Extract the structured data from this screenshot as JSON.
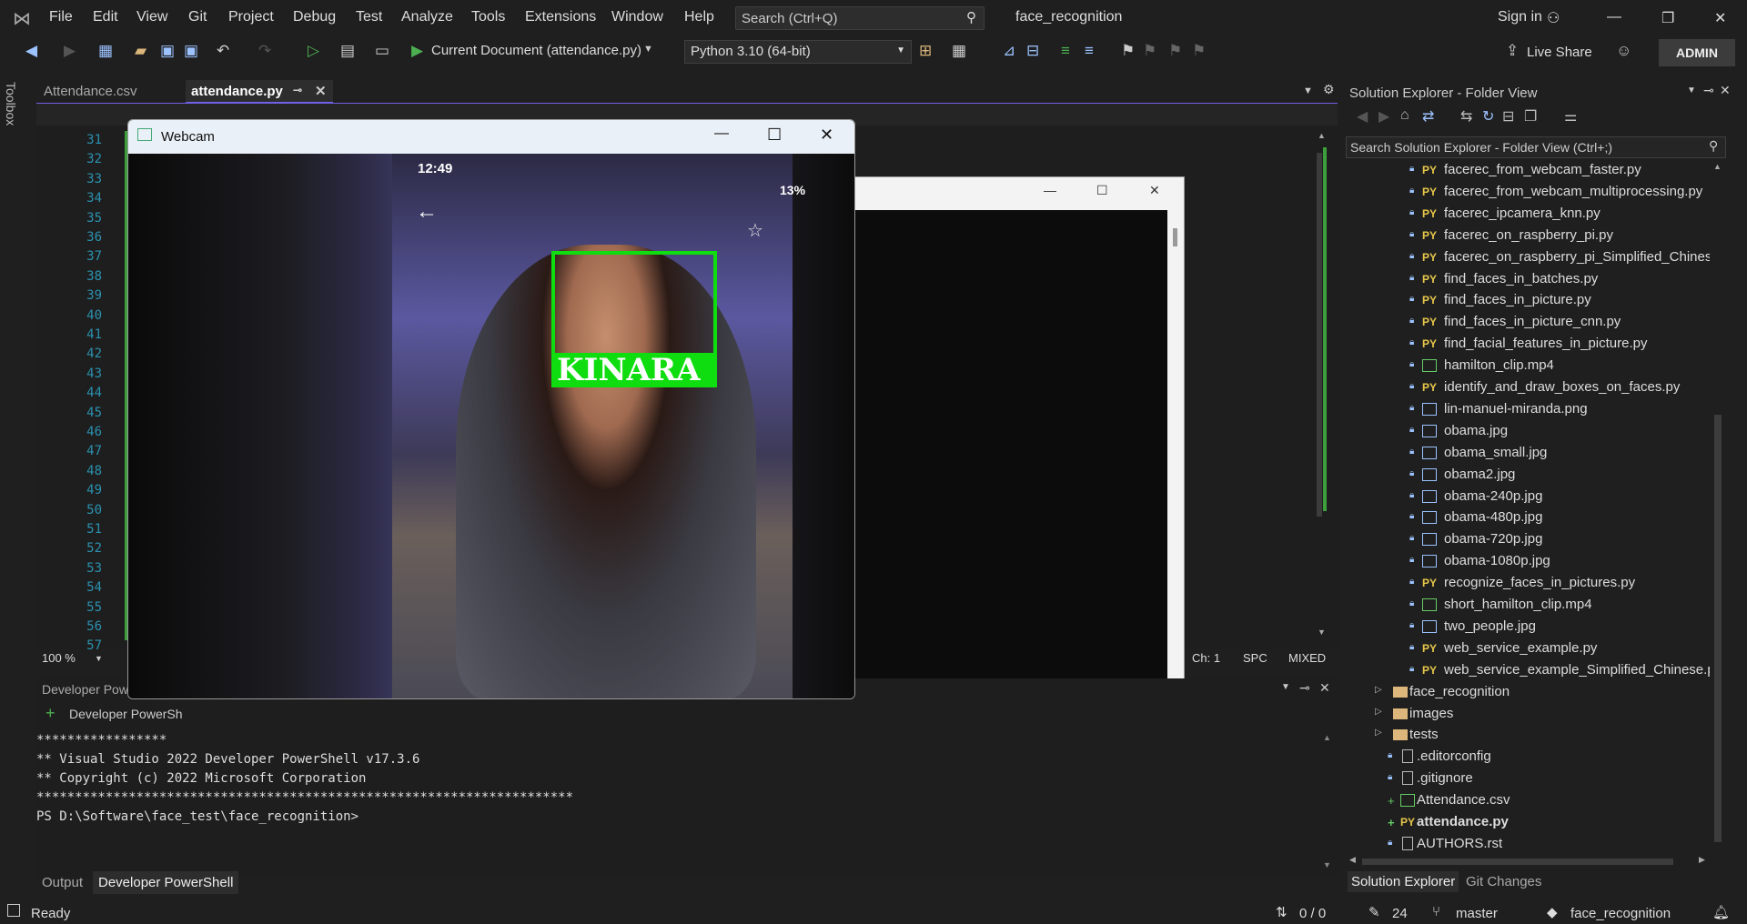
{
  "menu": {
    "items": [
      "File",
      "Edit",
      "View",
      "Git",
      "Project",
      "Debug",
      "Test",
      "Analyze",
      "Tools",
      "Extensions",
      "Window",
      "Help"
    ],
    "search_placeholder": "Search (Ctrl+Q)",
    "solution_name": "face_recognition",
    "sign_in": "Sign in"
  },
  "toolbar": {
    "run_target": "Current Document (attendance.py)",
    "interpreter": "Python 3.10 (64-bit)",
    "live_share": "Live Share",
    "admin": "ADMIN"
  },
  "left_rail": {
    "toolbox": "Toolbox"
  },
  "editor": {
    "tabs": [
      "Attendance.csv",
      "attendance.py"
    ],
    "line_numbers": [
      "31",
      "32",
      "33",
      "34",
      "35",
      "36",
      "37",
      "38",
      "39",
      "40",
      "41",
      "42",
      "43",
      "44",
      "45",
      "46",
      "47",
      "48",
      "49",
      "50",
      "51",
      "52",
      "53",
      "54",
      "55",
      "56",
      "57"
    ],
    "zoom": "100 %",
    "ch": "Ch: 1",
    "spc": "SPC",
    "mixed": "MIXED"
  },
  "webcam": {
    "title": "Webcam",
    "phone_time": "12:49",
    "phone_battery": "13%",
    "face_label": "KINARA"
  },
  "terminal": {
    "panel_title": "Developer Powe",
    "tab_label": "Developer PowerSh",
    "lines": [
      "*****************",
      "** Visual Studio 2022 Developer PowerShell v17.3.6",
      "** Copyright (c) 2022 Microsoft Corporation",
      "**********************************************************************",
      "PS D:\\Software\\face_test\\face_recognition>"
    ]
  },
  "bottom_tabs": {
    "output": "Output",
    "powershell": "Developer PowerShell"
  },
  "solution_explorer": {
    "title": "Solution Explorer - Folder View",
    "search_placeholder": "Search Solution Explorer - Folder View (Ctrl+;)",
    "items": [
      {
        "name": "facerec_from_webcam_faster.py",
        "type": "py",
        "indent": 1
      },
      {
        "name": "facerec_from_webcam_multiprocessing.py",
        "type": "py",
        "indent": 1
      },
      {
        "name": "facerec_ipcamera_knn.py",
        "type": "py",
        "indent": 1
      },
      {
        "name": "facerec_on_raspberry_pi.py",
        "type": "py",
        "indent": 1
      },
      {
        "name": "facerec_on_raspberry_pi_Simplified_Chinese.py",
        "type": "py",
        "indent": 1
      },
      {
        "name": "find_faces_in_batches.py",
        "type": "py",
        "indent": 1
      },
      {
        "name": "find_faces_in_picture.py",
        "type": "py",
        "indent": 1
      },
      {
        "name": "find_faces_in_picture_cnn.py",
        "type": "py",
        "indent": 1
      },
      {
        "name": "find_facial_features_in_picture.py",
        "type": "py",
        "indent": 1
      },
      {
        "name": "hamilton_clip.mp4",
        "type": "video",
        "indent": 1
      },
      {
        "name": "identify_and_draw_boxes_on_faces.py",
        "type": "py",
        "indent": 1
      },
      {
        "name": "lin-manuel-miranda.png",
        "type": "img",
        "indent": 1
      },
      {
        "name": "obama.jpg",
        "type": "img",
        "indent": 1
      },
      {
        "name": "obama_small.jpg",
        "type": "img",
        "indent": 1
      },
      {
        "name": "obama2.jpg",
        "type": "img",
        "indent": 1
      },
      {
        "name": "obama-240p.jpg",
        "type": "img",
        "indent": 1
      },
      {
        "name": "obama-480p.jpg",
        "type": "img",
        "indent": 1
      },
      {
        "name": "obama-720p.jpg",
        "type": "img",
        "indent": 1
      },
      {
        "name": "obama-1080p.jpg",
        "type": "img",
        "indent": 1
      },
      {
        "name": "recognize_faces_in_pictures.py",
        "type": "py",
        "indent": 1
      },
      {
        "name": "short_hamilton_clip.mp4",
        "type": "video",
        "indent": 1
      },
      {
        "name": "two_people.jpg",
        "type": "img",
        "indent": 1
      },
      {
        "name": "web_service_example.py",
        "type": "py",
        "indent": 1
      },
      {
        "name": "web_service_example_Simplified_Chinese.py",
        "type": "py",
        "indent": 1
      },
      {
        "name": "face_recognition",
        "type": "folder",
        "indent": 0
      },
      {
        "name": "images",
        "type": "folder",
        "indent": 0
      },
      {
        "name": "tests",
        "type": "folder",
        "indent": 0
      },
      {
        "name": ".editorconfig",
        "type": "file",
        "indent": 0
      },
      {
        "name": ".gitignore",
        "type": "file",
        "indent": 0
      },
      {
        "name": "Attendance.csv",
        "type": "csv",
        "indent": 0
      },
      {
        "name": "attendance.py",
        "type": "py",
        "indent": 0
      },
      {
        "name": "AUTHORS.rst",
        "type": "file",
        "indent": 0
      }
    ],
    "tab_se": "Solution Explorer",
    "tab_git": "Git Changes"
  },
  "status": {
    "ready": "Ready",
    "updown": "0 / 0",
    "edits": "24",
    "branch": "master",
    "repo": "face_recognition"
  }
}
